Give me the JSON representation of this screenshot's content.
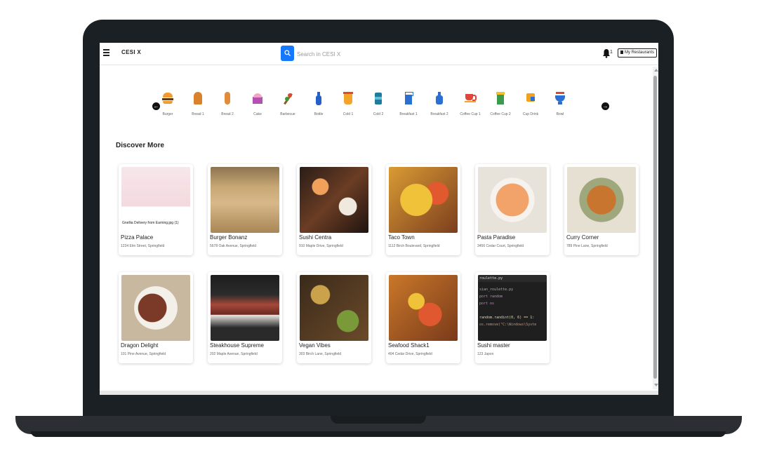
{
  "app": {
    "title": "CESI X"
  },
  "header": {
    "search_placeholder": "Search in CESI X",
    "notification_count": "1",
    "my_restaurants_label": "My Restaurants"
  },
  "categories": [
    {
      "label": "Burger",
      "icon": "burger-icon",
      "color": "#f29a2e"
    },
    {
      "label": "Bread 1",
      "icon": "bread-icon",
      "color": "#d9822b"
    },
    {
      "label": "Bread 2",
      "icon": "baguette-icon",
      "color": "#e08c3a"
    },
    {
      "label": "Cake",
      "icon": "cake-icon",
      "color": "#b64fb4"
    },
    {
      "label": "Barbecue",
      "icon": "skewer-icon",
      "color": "#d84a2b"
    },
    {
      "label": "Bottle",
      "icon": "bottle-icon",
      "color": "#2460c8"
    },
    {
      "label": "Cold 1",
      "icon": "cup-icon",
      "color": "#f2a42b"
    },
    {
      "label": "Cold 2",
      "icon": "can-icon",
      "color": "#1f7a9c"
    },
    {
      "label": "Breakfast 1",
      "icon": "milk-carton-icon",
      "color": "#2b6fd1"
    },
    {
      "label": "Breakfast 2",
      "icon": "milk-bottle-icon",
      "color": "#2b6fd1"
    },
    {
      "label": "Coffee Cup 1",
      "icon": "coffee-cup-icon",
      "color": "#e0463a"
    },
    {
      "label": "Coffee Cup 2",
      "icon": "coffee-takeaway-icon",
      "color": "#3d9a4c"
    },
    {
      "label": "Cup Drink",
      "icon": "cup-drink-icon",
      "color": "#f0a21f"
    },
    {
      "label": "Bowl",
      "icon": "bowl-icon",
      "color": "#2b6fd1"
    }
  ],
  "discover": {
    "title": "Discover More",
    "restaurants": [
      {
        "name": "Pizza Palace",
        "address": "1234 Elm Street, Springfield",
        "image_caption": "Gnellia Delivery from Earning.jpg (1)"
      },
      {
        "name": "Burger Bonanz",
        "address": "5678 Oak Avenue, Springfield"
      },
      {
        "name": "Sushi Centra",
        "address": "910 Maple Drive, Springfield"
      },
      {
        "name": "Taco Town",
        "address": "1112 Birch Boulevard, Springfield"
      },
      {
        "name": "Pasta Paradise",
        "address": "3456 Cedar Court, Springfield"
      },
      {
        "name": "Curry Corner",
        "address": "789 Pine Lane, Springfield"
      },
      {
        "name": "Dragon Delight",
        "address": "101 Pine Avenue, Springfield"
      },
      {
        "name": "Steakhouse Supreme",
        "address": "202 Maple Avenue, Springfield"
      },
      {
        "name": "Vegan Vibes",
        "address": "303 Birch Lane, Springfield"
      },
      {
        "name": "Seafood Shack1",
        "address": "404 Cedar Drive, Springfield"
      },
      {
        "name": "Sushi master",
        "address": "123 Japon"
      }
    ],
    "code_snippet": {
      "tab": "roulette.py",
      "lines": [
        "sian_roulette.py",
        "port random",
        "port os",
        "",
        "random.randint(0, 6) == 1:",
        "  os.remove(\"C:\\Windows\\Syste"
      ]
    }
  }
}
